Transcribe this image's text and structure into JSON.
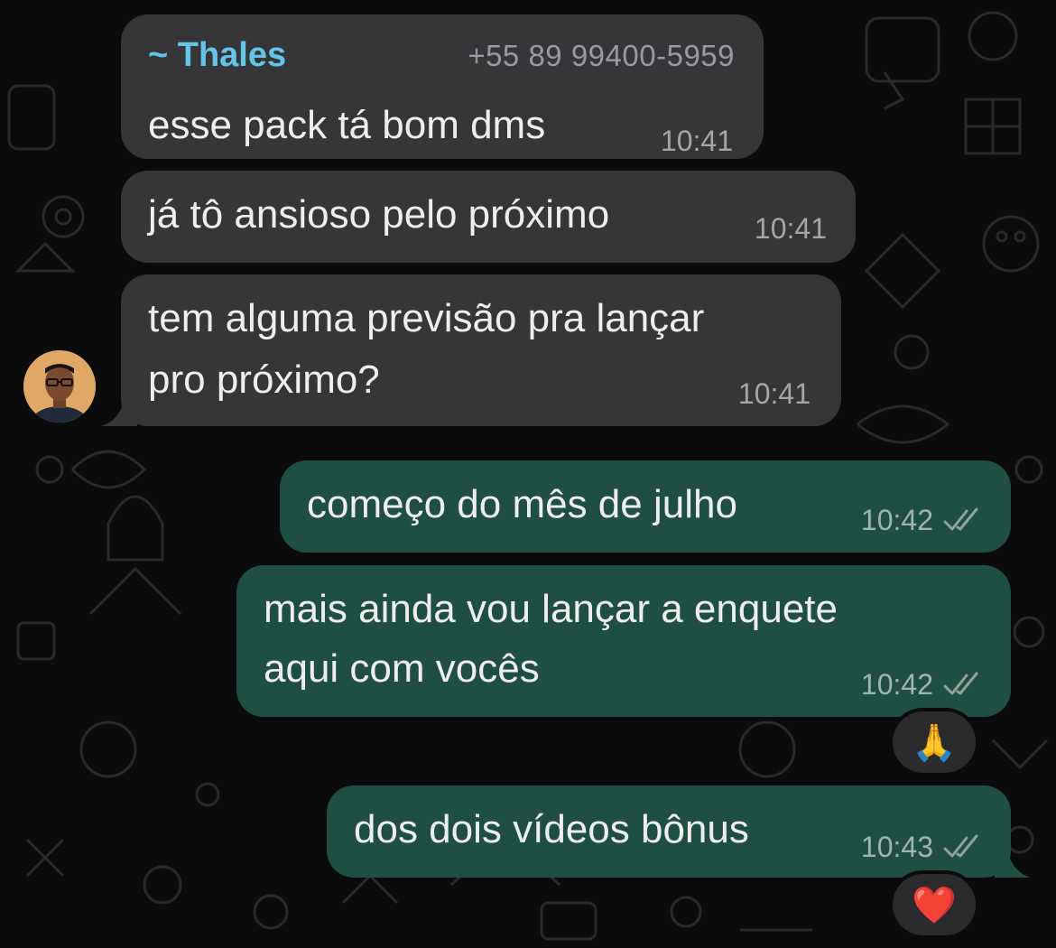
{
  "chat": {
    "sender": {
      "name": "~ Thales",
      "phone": "+55 89 99400-5959"
    },
    "incoming": [
      {
        "text": "esse pack tá bom dms",
        "time": "10:41"
      },
      {
        "text": "já tô ansioso pelo próximo",
        "time": "10:41"
      },
      {
        "line1": "tem alguma previsão pra lançar",
        "line2": "pro próximo?",
        "time": "10:41"
      }
    ],
    "outgoing": [
      {
        "text": "começo do mês de julho",
        "time": "10:42"
      },
      {
        "line1": "mais ainda vou lançar a enquete",
        "line2": "aqui com vocês",
        "time": "10:42",
        "reaction": "🙏"
      },
      {
        "text": "dos dois vídeos bônus",
        "time": "10:43",
        "reaction": "❤️"
      }
    ]
  },
  "colors": {
    "incoming_bubble": "#363638",
    "outgoing_bubble": "#1f4f43",
    "sender_name": "#63c6e8",
    "background": "#0b0b0b"
  },
  "icons": {
    "read_receipt": "double-check-icon",
    "avatar": "contact-avatar"
  }
}
